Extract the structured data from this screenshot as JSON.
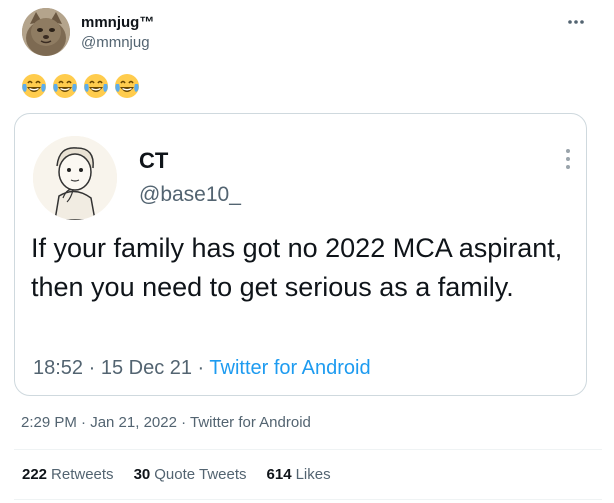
{
  "tweet": {
    "author_name": "mmnjug™",
    "author_handle": "@mmnjug",
    "emoji_text": "😂😂😂😂",
    "emoji_icon": "face-with-tears-of-joy-icon",
    "timestamp": "2:29 PM · Jan 21, 2022 · Twitter for Android"
  },
  "quote": {
    "name": "CT",
    "handle": "@base10_",
    "text": "If your family has got no 2022 MCA aspirant, then you need to get serious as a family.",
    "time": "18:52 · 15 Dec 21 · ",
    "source": "Twitter for Android"
  },
  "stats": {
    "retweets_count": "222",
    "retweets_label": "Retweets",
    "quotes_count": "30",
    "quotes_label": "Quote Tweets",
    "likes_count": "614",
    "likes_label": "Likes"
  },
  "colors": {
    "text_primary": "#0f1419",
    "text_secondary": "#536471",
    "link": "#1d9bf0",
    "border": "#cfd9de"
  }
}
